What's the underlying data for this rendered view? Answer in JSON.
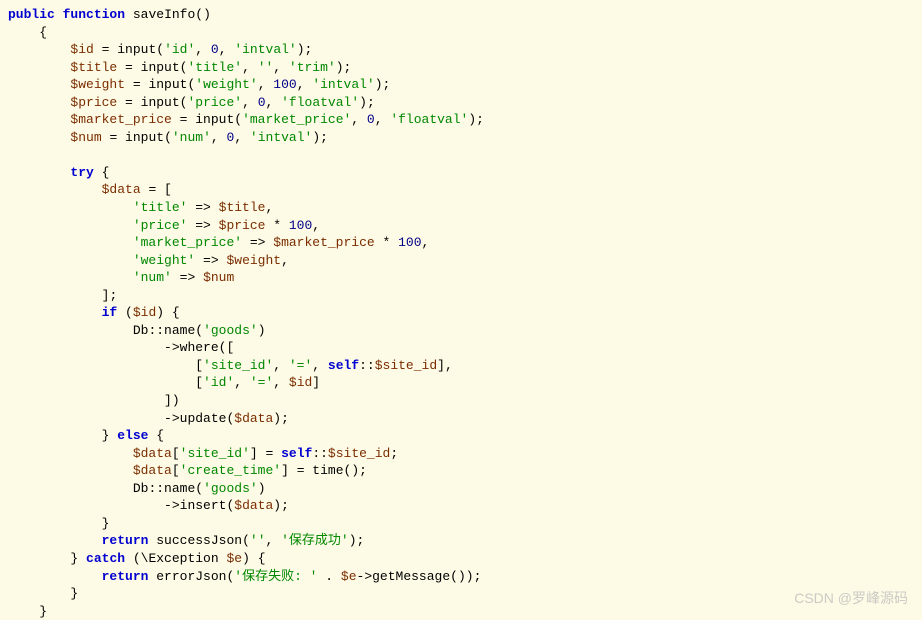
{
  "code": {
    "line01": {
      "kw1": "public",
      "kw2": "function",
      "fn": "saveInfo",
      "lp": "(",
      "rp": ")"
    },
    "line02": {
      "brace": "{"
    },
    "line03": {
      "var": "$id",
      "eq": " = ",
      "fn": "input",
      "lp": "(",
      "s": "'id'",
      "c1": ", ",
      "n": "0",
      "c2": ", ",
      "s2": "'intval'",
      "rp": ")",
      "sc": ";"
    },
    "line04": {
      "var": "$title",
      "eq": " = ",
      "fn": "input",
      "lp": "(",
      "s": "'title'",
      "c1": ", ",
      "s2": "''",
      "c2": ", ",
      "s3": "'trim'",
      "rp": ")",
      "sc": ";"
    },
    "line05": {
      "var": "$weight",
      "eq": " = ",
      "fn": "input",
      "lp": "(",
      "s": "'weight'",
      "c1": ", ",
      "n": "100",
      "c2": ", ",
      "s2": "'intval'",
      "rp": ")",
      "sc": ";"
    },
    "line06": {
      "var": "$price",
      "eq": " = ",
      "fn": "input",
      "lp": "(",
      "s": "'price'",
      "c1": ", ",
      "n": "0",
      "c2": ", ",
      "s2": "'floatval'",
      "rp": ")",
      "sc": ";"
    },
    "line07": {
      "var": "$market_price",
      "eq": " = ",
      "fn": "input",
      "lp": "(",
      "s": "'market_price'",
      "c1": ", ",
      "n": "0",
      "c2": ", ",
      "s2": "'floatval'",
      "rp": ")",
      "sc": ";"
    },
    "line08": {
      "var": "$num",
      "eq": " = ",
      "fn": "input",
      "lp": "(",
      "s": "'num'",
      "c1": ", ",
      "n": "0",
      "c2": ", ",
      "s2": "'intval'",
      "rp": ")",
      "sc": ";"
    },
    "line10": {
      "kw": "try",
      "brace": " {"
    },
    "line11": {
      "var": "$data",
      "eq": " = ",
      "lb": "["
    },
    "line12": {
      "s": "'title'",
      "arrow": " => ",
      "var": "$title",
      "c": ","
    },
    "line13": {
      "s": "'price'",
      "arrow": " => ",
      "var": "$price",
      "mul": " * ",
      "n": "100",
      "c": ","
    },
    "line14": {
      "s": "'market_price'",
      "arrow": " => ",
      "var": "$market_price",
      "mul": " * ",
      "n": "100",
      "c": ","
    },
    "line15": {
      "s": "'weight'",
      "arrow": " => ",
      "var": "$weight",
      "c": ","
    },
    "line16": {
      "s": "'num'",
      "arrow": " => ",
      "var": "$num"
    },
    "line17": {
      "rb": "]",
      "sc": ";"
    },
    "line18": {
      "kw": "if",
      "sp": " (",
      "var": "$id",
      "rp": ") {"
    },
    "line19": {
      "cls": "Db",
      "dd": "::",
      "fn": "name",
      "lp": "(",
      "s": "'goods'",
      "rp": ")"
    },
    "line20": {
      "arrow": "->",
      "fn": "where",
      "lp": "(",
      "lb": "["
    },
    "line21": {
      "lb": "[",
      "s": "'site_id'",
      "c1": ", ",
      "s2": "'='",
      "c2": ", ",
      "kw": "self",
      "dd": "::",
      "var": "$site_id",
      "rb": "]",
      "c": ","
    },
    "line22": {
      "lb": "[",
      "s": "'id'",
      "c1": ", ",
      "s2": "'='",
      "c2": ", ",
      "var": "$id",
      "rb": "]"
    },
    "line23": {
      "rb": "]",
      "rp": ")"
    },
    "line24": {
      "arrow": "->",
      "fn": "update",
      "lp": "(",
      "var": "$data",
      "rp": ")",
      "sc": ";"
    },
    "line25": {
      "rb": "}",
      "kw": " else",
      "brace": " {"
    },
    "line26": {
      "var": "$data",
      "lb": "[",
      "s": "'site_id'",
      "rb": "]",
      "eq": " = ",
      "kw": "self",
      "dd": "::",
      "var2": "$site_id",
      "sc": ";"
    },
    "line27": {
      "var": "$data",
      "lb": "[",
      "s": "'create_time'",
      "rb": "]",
      "eq": " = ",
      "fn": "time",
      "lp": "(",
      "rp": ")",
      "sc": ";"
    },
    "line28": {
      "cls": "Db",
      "dd": "::",
      "fn": "name",
      "lp": "(",
      "s": "'goods'",
      "rp": ")"
    },
    "line29": {
      "arrow": "->",
      "fn": "insert",
      "lp": "(",
      "var": "$data",
      "rp": ")",
      "sc": ";"
    },
    "line30": {
      "rb": "}"
    },
    "line31": {
      "kw": "return",
      "sp": " ",
      "fn": "successJson",
      "lp": "(",
      "s": "''",
      "c": ", ",
      "s2": "'保存成功'",
      "rp": ")",
      "sc": ";"
    },
    "line32": {
      "rb": "}",
      "kw": " catch",
      "sp": " (\\",
      "cls": "Exception",
      "sp2": " ",
      "var": "$e",
      "rp": ") {"
    },
    "line33": {
      "kw": "return",
      "sp": " ",
      "fn": "errorJson",
      "lp": "(",
      "s": "'保存失败: '",
      "cat": " . ",
      "var": "$e",
      "arrow": "->",
      "fn2": "getMessage",
      "lp2": "(",
      "rp2": ")",
      "rp": ")",
      "sc": ";"
    },
    "line34": {
      "rb": "}"
    },
    "line35": {
      "rb": "}"
    }
  },
  "watermark": "CSDN @罗峰源码"
}
